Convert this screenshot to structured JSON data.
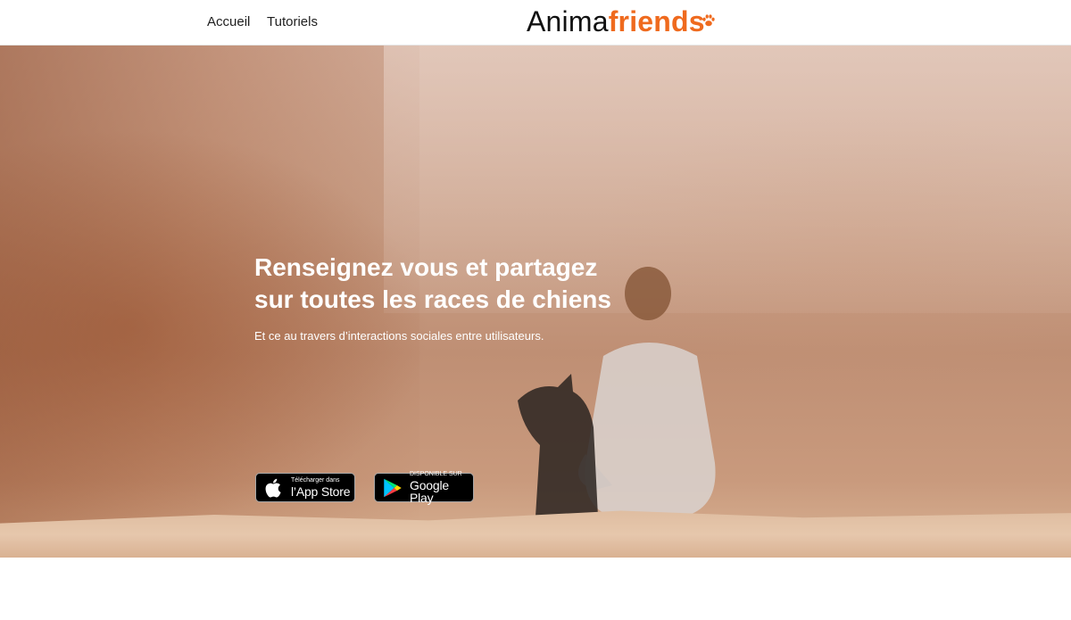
{
  "nav": {
    "links": [
      "Accueil",
      "Tutoriels"
    ],
    "logo": {
      "part1": "Anima",
      "part2": "friends"
    }
  },
  "hero": {
    "title_line1": "Renseignez vous et partagez",
    "title_line2": "sur toutes les races de chiens",
    "subtitle": "Et ce au travers d’interactions sociales entre utilisateurs.",
    "appstore": {
      "small": "Télécharger dans",
      "big": "l’App Store",
      "icon": "apple-icon"
    },
    "googleplay": {
      "small": "DISPONIBLE SUR",
      "big": "Google Play",
      "icon": "google-play-icon"
    }
  },
  "colors": {
    "brand_orange": "#ef6a1e",
    "text_dark": "#1f1f1f",
    "store_black": "#000000"
  }
}
